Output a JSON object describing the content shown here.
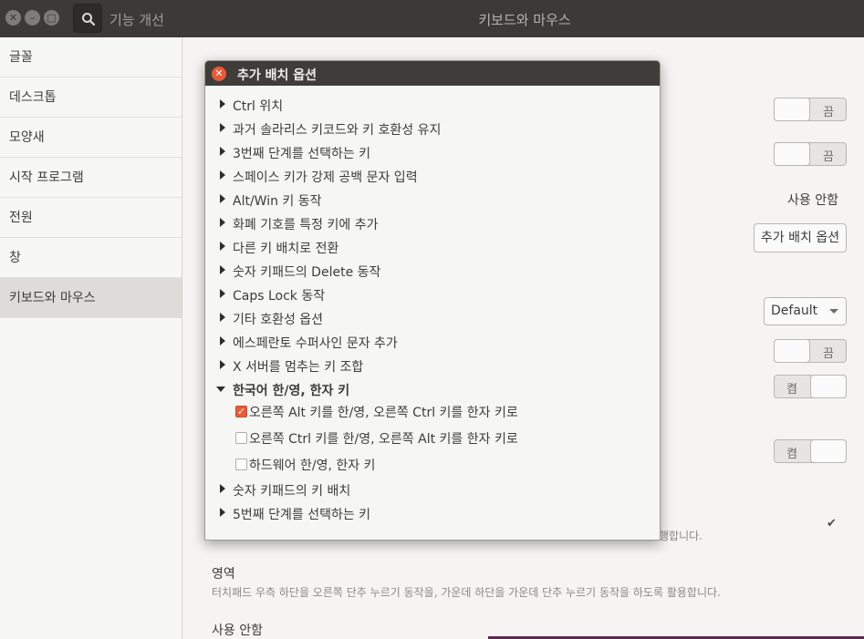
{
  "header": {
    "search_title": "기능 개선",
    "title": "키보드와 마우스"
  },
  "sidebar": {
    "items": [
      {
        "label": "글꼴"
      },
      {
        "label": "데스크톱"
      },
      {
        "label": "모양새"
      },
      {
        "label": "시작 프로그램"
      },
      {
        "label": "전원"
      },
      {
        "label": "창"
      },
      {
        "label": "키보드와 마우스"
      }
    ],
    "active_index": 6
  },
  "main": {
    "toggle_1": {
      "label": "끔",
      "state": "off"
    },
    "toggle_2": {
      "label": "끔",
      "state": "off"
    },
    "unused_text": "사용 안함",
    "extra_layout_button": "추가 배치 옵션",
    "dropdown_value": "Default",
    "toggle_3": {
      "label": "끔",
      "state": "off"
    },
    "toggle_4": {
      "label": "켬",
      "state": "on"
    },
    "toggle_5": {
      "label": "켬",
      "state": "on"
    },
    "partial_desc": "행합니다.",
    "area_title": "영역",
    "area_desc": "터치패드 우측 하단을 오른쪽 단추 누르기 동작을, 가운데 하단을 가운데 단추 누르기 동작을 하도록 활용합니다.",
    "bottom_label": "사용 안함"
  },
  "dialog": {
    "title": "추가 배치 옵션",
    "items": [
      {
        "label": "Ctrl 위치"
      },
      {
        "label": "과거 솔라리스 키코드와 키 호환성 유지"
      },
      {
        "label": "3번째 단계를 선택하는 키"
      },
      {
        "label": "스페이스 키가 강제 공백 문자 입력"
      },
      {
        "label": "Alt/Win 키 동작"
      },
      {
        "label": "화폐 기호를 특정 키에 추가"
      },
      {
        "label": "다른 키 배치로 전환"
      },
      {
        "label": "숫자 키패드의 Delete 동작"
      },
      {
        "label": "Caps Lock 동작"
      },
      {
        "label": "기타 호환성 옵션"
      },
      {
        "label": "에스페란토 수퍼사인 문자 추가"
      },
      {
        "label": "X 서버를 멈추는 키 조합"
      },
      {
        "label": "한국어 한/영, 한자 키"
      }
    ],
    "korean_options": [
      {
        "label": "오른쪽 Alt 키를 한/영, 오른쪽 Ctrl 키를 한자 키로",
        "checked": true
      },
      {
        "label": "오른쪽 Ctrl 키를 한/영, 오른쪽 Alt 키를 한자 키로",
        "checked": false
      },
      {
        "label": "하드웨어 한/영, 한자 키",
        "checked": false
      }
    ],
    "items_after": [
      {
        "label": "숫자 키패드의 키 배치"
      },
      {
        "label": "5번째 단계를 선택하는 키"
      }
    ]
  }
}
